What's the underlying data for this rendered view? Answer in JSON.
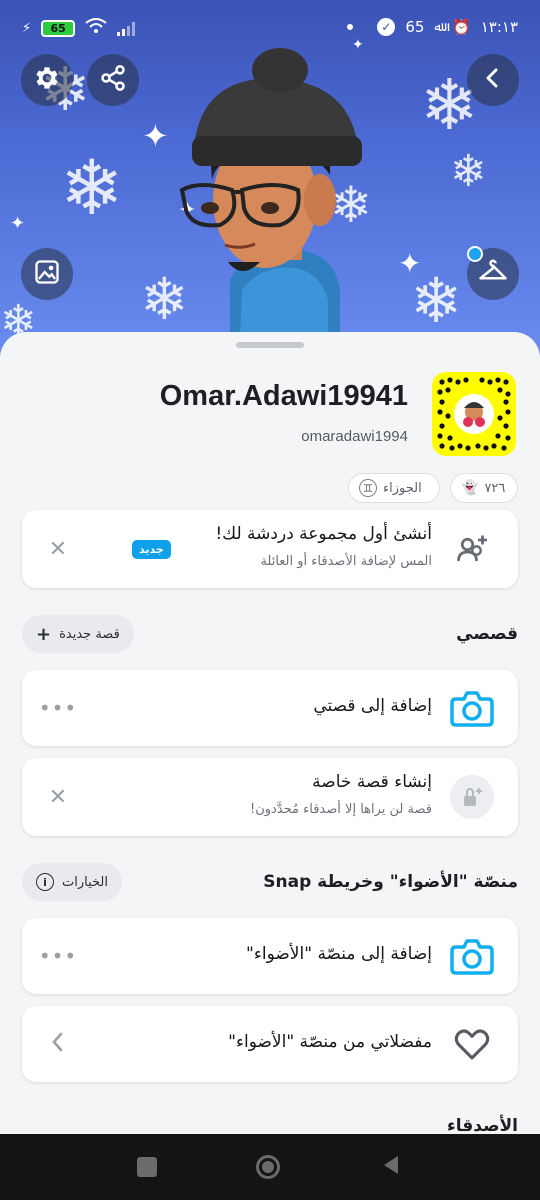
{
  "status_bar": {
    "battery": "65",
    "right_battery_text": "65",
    "time": "١٣:١٣"
  },
  "profile": {
    "display_name": "Omar.Adawi19941",
    "username": "omaradawi1994"
  },
  "chips": {
    "snap_score": "٧٢٦",
    "zodiac": "الجوزاء"
  },
  "group_card": {
    "title": "أنشئ أول مجموعة دردشة لك!",
    "subtitle": "المس لإضافة الأصدقاء أو العائلة",
    "badge": "جديد"
  },
  "my_story": {
    "section_title": "قصصي",
    "new_story_button": "قصة جديدة",
    "add_story_label": "إضافة إلى قصتي",
    "private_story_title": "إنشاء قصة خاصة",
    "private_story_subtitle": "قصة لن يراها إلا أصدقاء مُحدَّدون!"
  },
  "spotlight": {
    "section_title": "منصّة \"الأضواء\" وخريطة Snap",
    "options_button": "الخيارات",
    "add_label": "إضافة إلى منصّة \"الأضواء\"",
    "favorites_label": "مفضلاتي من منصّة \"الأضواء\""
  },
  "friends": {
    "section_title": "الأصدقاء"
  },
  "icons": {
    "settings": "gear-icon",
    "share": "share-icon",
    "back": "chevron-left-icon",
    "background": "image-icon",
    "outfit": "hanger-icon"
  },
  "colors": {
    "snapcode_yellow": "#fffc00",
    "accent_blue": "#0fa0ea",
    "banner_blue": "#4c6bd4"
  }
}
